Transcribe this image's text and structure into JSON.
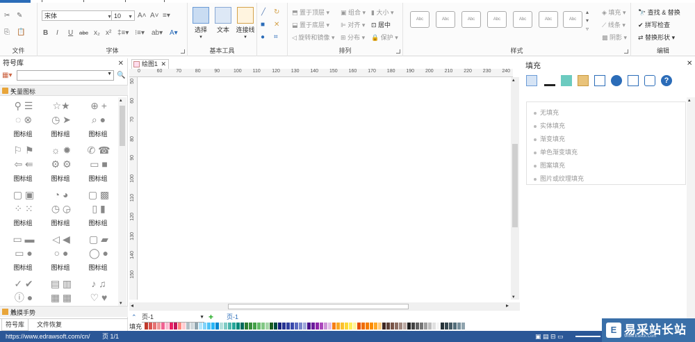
{
  "ribbon": {
    "groups": {
      "file": "文件",
      "font": "字体",
      "basic_tools": "基本工具",
      "arrange": "排列",
      "style": "样式",
      "edit": "编辑"
    },
    "font": {
      "name": "宋体",
      "size": "10"
    },
    "tools": {
      "select": "选择",
      "text": "文本",
      "connector": "连接线"
    },
    "arrange": {
      "bring_front": "置于顶层",
      "send_back": "置于底层",
      "rotate_flip": "旋转和镜像",
      "group": "组合",
      "align": "对齐",
      "distribute": "分布",
      "size": "大小",
      "center": "居中",
      "protect": "保护"
    },
    "style_thumb": "Abc",
    "fill_tools": {
      "fill": "填充",
      "line": "线条",
      "shadow": "阴影"
    },
    "edit": {
      "find_replace": "查找 & 替换",
      "spell_check": "拼写检查",
      "replace_shape": "替换形状"
    }
  },
  "left_panel": {
    "title": "符号库",
    "category": "矢量图标",
    "cell_label": "图标组",
    "second_category": "触摸手势",
    "tabs": [
      "符号库",
      "文件恢复"
    ]
  },
  "canvas": {
    "doc_tab": "绘图1",
    "h_ruler": [
      "0",
      "60",
      "70",
      "80",
      "90",
      "100",
      "110",
      "120",
      "130",
      "140",
      "150",
      "160",
      "170",
      "180",
      "190",
      "200",
      "210",
      "220",
      "230",
      "240"
    ],
    "v_ruler": [
      "50",
      "60",
      "70",
      "80",
      "90",
      "100",
      "110",
      "120",
      "130",
      "140",
      "150"
    ],
    "page_select": "页-1",
    "page_tab": "页-1",
    "palette_label": "填充"
  },
  "right_panel": {
    "title": "填充",
    "options": [
      "无填充",
      "实体填充",
      "渐变填充",
      "单色渐变填充",
      "图案填充",
      "图片或纹理填充"
    ]
  },
  "status": {
    "url": "https://www.edrawsoft.com/cn/",
    "page": "页 1/1"
  },
  "watermark": {
    "main": "易采站长站",
    "sub": "Www.Easck.Com"
  },
  "colors": {
    "status_bar": "#2b5797",
    "accent": "#2b6cb8"
  }
}
